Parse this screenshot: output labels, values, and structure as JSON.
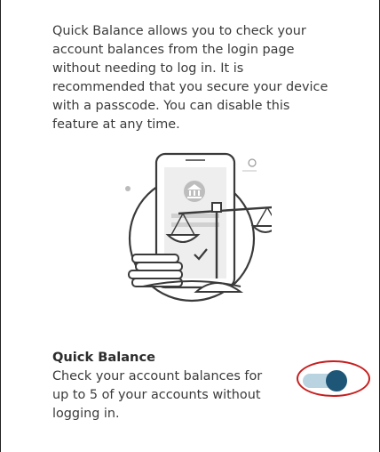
{
  "intro": {
    "text": "Quick Balance allows you to check your account balances from the login page without needing to log in. It is recommended that you secure your device with a passcode. You can disable this feature at any time."
  },
  "illustration": {
    "icon": "phone-scale-coins-illustration"
  },
  "setting": {
    "title": "Quick Balance",
    "description": "Check your account balances for up to 5 of your accounts without logging in.",
    "enabled": true
  },
  "colors": {
    "toggle_knob": "#1d5677",
    "toggle_track": "#b9d3e1",
    "highlight": "#c71e1e",
    "text": "#3a3a3a"
  }
}
